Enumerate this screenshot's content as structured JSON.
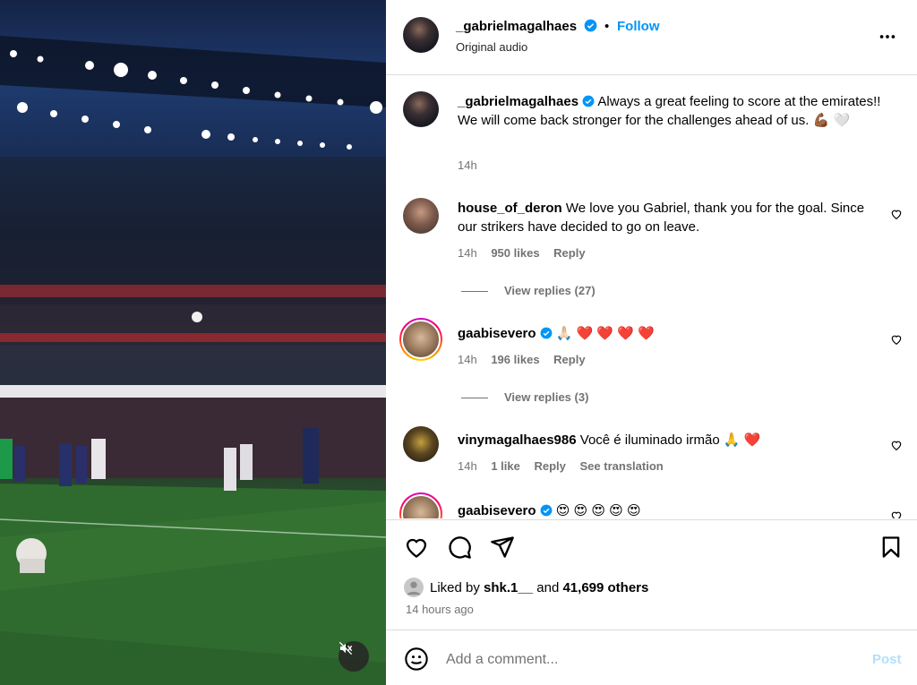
{
  "media": {
    "mute_icon": "speaker-muted-icon"
  },
  "header": {
    "username": "_gabrielmagalhaes",
    "separator": "•",
    "follow_label": "Follow",
    "audio_label": "Original audio"
  },
  "caption": {
    "username": "_gabrielmagalhaes",
    "text": "Always a great feeling to score at the emirates!! We will come back stronger for the challenges ahead of us. 💪🏾 🤍",
    "time": "14h"
  },
  "comments": [
    {
      "username": "house_of_deron",
      "text": "We love you Gabriel, thank you for the goal. Since our strikers have decided to go on leave.",
      "time": "14h",
      "likes": "950 likes",
      "reply": "Reply",
      "view_replies": "View replies (27)"
    },
    {
      "username": "gaabisevero",
      "text": "🙏🏻 ❤️ ❤️ ❤️ ❤️",
      "time": "14h",
      "likes": "196 likes",
      "reply": "Reply",
      "view_replies": "View replies (3)"
    },
    {
      "username": "vinymagalhaes986",
      "text": "Você é iluminado irmão 🙏 ❤️",
      "time": "14h",
      "likes": "1 like",
      "reply": "Reply",
      "translation": "See translation"
    },
    {
      "username": "gaabisevero",
      "text": "😍 😍 😍 😍 😍"
    }
  ],
  "likes_line": {
    "prefix": "Liked by",
    "user": "shk.1__",
    "middle": "and",
    "others": "41,699 others"
  },
  "posted_time": "14 hours ago",
  "add_comment": {
    "placeholder": "Add a comment...",
    "post_label": "Post"
  },
  "colors": {
    "follow": "#0095f6",
    "post_disabled": "#b2dffc",
    "muted_text": "#737373",
    "heart": "#e0245e"
  }
}
